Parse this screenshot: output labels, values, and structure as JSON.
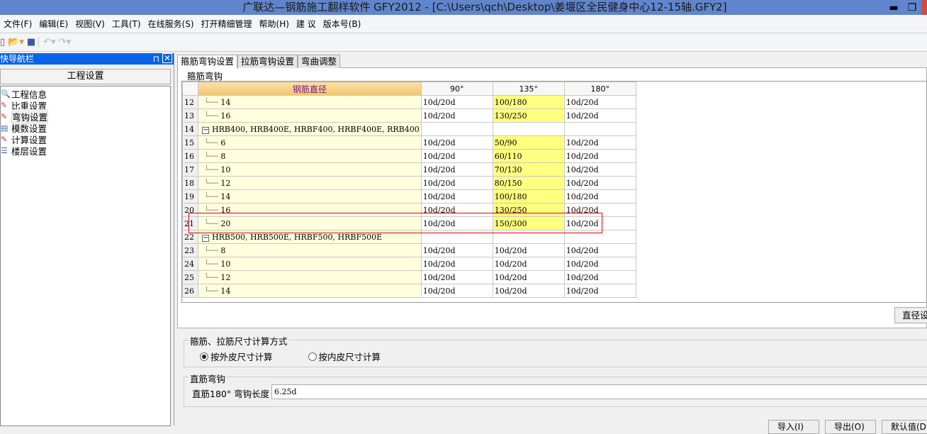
{
  "title": "广联达—钢筋施工翻样软件 GFY2012 - [C:\\Users\\qch\\Desktop\\姜堰区全民健身中心12-15轴.GFY2]",
  "menu": [
    "文件(F)",
    "编辑(E)",
    "视图(V)",
    "工具(T)",
    "在线服务(S)",
    "打开精细管理",
    "帮助(H)",
    "建 议",
    "版本号(B)"
  ],
  "nav": {
    "title": "快导航栏",
    "pin": "⊓",
    "close": "✕",
    "group": "工程设置",
    "items": [
      {
        "label": "工程信息"
      },
      {
        "label": "比重设置"
      },
      {
        "label": "弯钩设置",
        "selected": true
      },
      {
        "label": "模数设置"
      },
      {
        "label": "计算设置"
      },
      {
        "label": "楼层设置"
      }
    ]
  },
  "tabs": [
    "箍筋弯钩设置",
    "拉筋弯钩设置",
    "弯曲调整"
  ],
  "group_title": "箍筋弯钩",
  "table": {
    "headers": [
      "钢筋直径",
      "90°",
      "135°",
      "180°"
    ],
    "rows": [
      {
        "n": "12",
        "d": "14",
        "a": "10d/20d",
        "b": "100/180",
        "c": "10d/20d"
      },
      {
        "n": "13",
        "d": "16",
        "a": "10d/20d",
        "b": "130/250",
        "c": "10d/20d"
      },
      {
        "n": "14",
        "group": "HRB400, HRB400E, HRBF400, HRBF400E, RRB400"
      },
      {
        "n": "15",
        "d": "6",
        "a": "10d/20d",
        "b": "50/90",
        "c": "10d/20d"
      },
      {
        "n": "16",
        "d": "8",
        "a": "10d/20d",
        "b": "60/110",
        "c": "10d/20d"
      },
      {
        "n": "17",
        "d": "10",
        "a": "10d/20d",
        "b": "70/130",
        "c": "10d/20d"
      },
      {
        "n": "18",
        "d": "12",
        "a": "10d/20d",
        "b": "80/150",
        "c": "10d/20d"
      },
      {
        "n": "19",
        "d": "14",
        "a": "10d/20d",
        "b": "100/180",
        "c": "10d/20d"
      },
      {
        "n": "20",
        "d": "16",
        "a": "10d/20d",
        "b": "130/250",
        "c": "10d/20d"
      },
      {
        "n": "21",
        "d": "20",
        "a": "10d/20d",
        "b": "150/300",
        "c": "10d/20d"
      },
      {
        "n": "22",
        "group": "HRB500, HRB500E, HRBF500, HRBF500E"
      },
      {
        "n": "23",
        "d": "8",
        "a": "10d/20d",
        "b": "10d/20d",
        "c": "10d/20d"
      },
      {
        "n": "24",
        "d": "10",
        "a": "10d/20d",
        "b": "10d/20d",
        "c": "10d/20d"
      },
      {
        "n": "25",
        "d": "12",
        "a": "10d/20d",
        "b": "10d/20d",
        "c": "10d/20d"
      },
      {
        "n": "26",
        "d": "14",
        "a": "10d/20d",
        "b": "10d/20d",
        "c": "10d/20d"
      }
    ]
  },
  "diameter_button": "直径设",
  "calc": {
    "title": "箍筋、拉筋尺寸计算方式",
    "opt1": "按外皮尺寸计算",
    "opt2": "按内皮尺寸计算"
  },
  "straight": {
    "title": "直筋弯钩",
    "label": "直筋180° 弯钩长度",
    "value": "6.25d"
  },
  "bottom_buttons": [
    "导入(I)",
    "导出(O)",
    "默认值(D)"
  ]
}
